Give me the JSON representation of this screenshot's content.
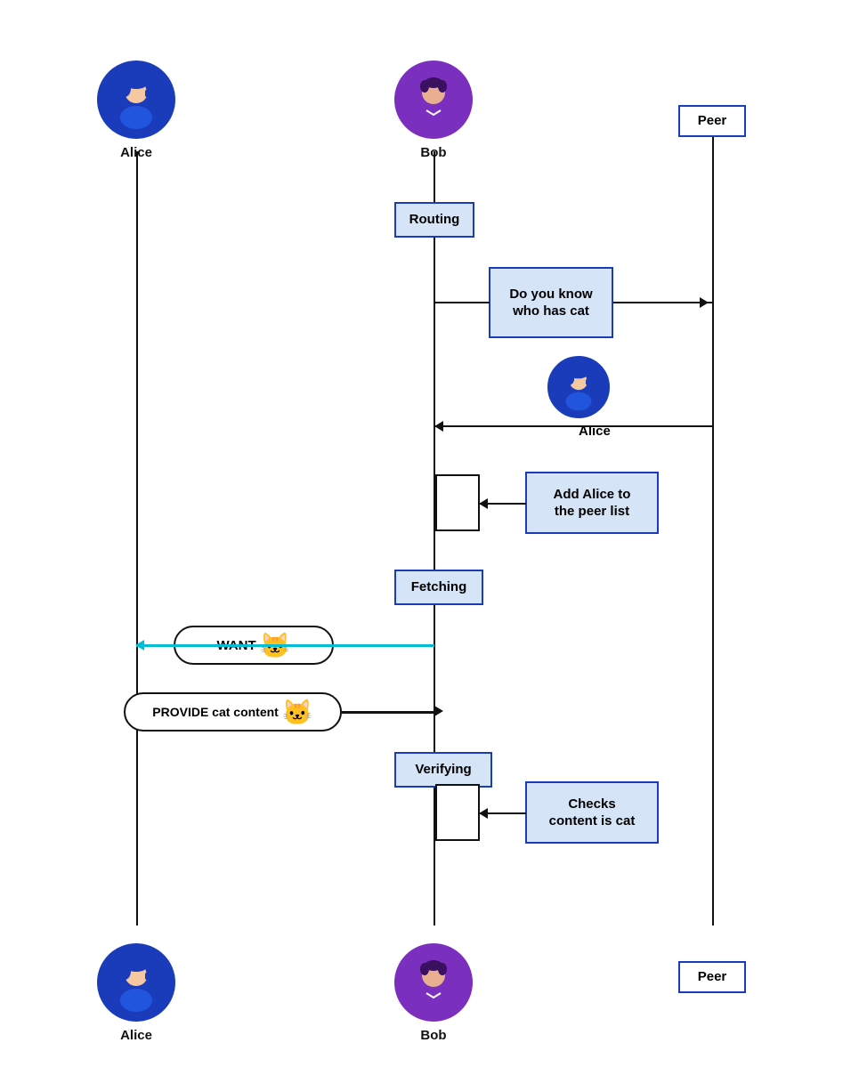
{
  "actors": {
    "alice_top_label": "Alice",
    "bob_top_label": "Bob",
    "peer_top_label": "Peer",
    "alice_bottom_label": "Alice",
    "bob_bottom_label": "Bob",
    "peer_bottom_label": "Peer"
  },
  "steps": {
    "routing_label": "Routing",
    "do_you_know_label": "Do you know\nwho has cat",
    "alice_response_label": "Alice",
    "add_alice_label": "Add Alice to\nthe peer list",
    "fetching_label": "Fetching",
    "want_label": "WANT",
    "provide_label": "PROVIDE cat content",
    "verifying_label": "Verifying",
    "checks_label": "Checks\ncontent is cat"
  }
}
